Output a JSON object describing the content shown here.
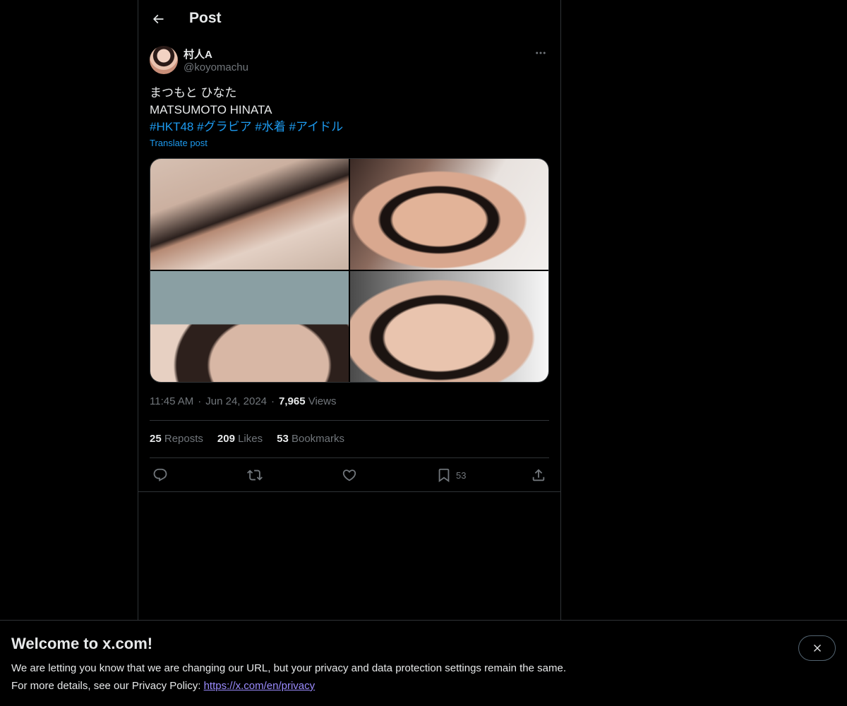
{
  "header": {
    "title": "Post",
    "back_icon": "arrow-left-icon"
  },
  "author": {
    "name": "村人A",
    "handle": "@koyomachu"
  },
  "post": {
    "line1": "まつもと ひなた",
    "line2": "MATSUMOTO HINATA",
    "hashtags": [
      "#HKT48",
      "#グラビア",
      "#水着",
      "#アイドル"
    ],
    "translate_label": "Translate post",
    "media_count": 4
  },
  "meta": {
    "time": "11:45 AM",
    "date": "Jun 24, 2024",
    "views_count": "7,965",
    "views_label": "Views",
    "separator": "·"
  },
  "stats": {
    "reposts_count": "25",
    "reposts_label": "Reposts",
    "likes_count": "209",
    "likes_label": "Likes",
    "bookmarks_count": "53",
    "bookmarks_label": "Bookmarks"
  },
  "actions": {
    "bookmark_count": "53"
  },
  "banner": {
    "title": "Welcome to x.com!",
    "line1": "We are letting you know that we are changing our URL, but your privacy and data protection settings remain the same.",
    "line2_prefix": "For more details, see our Privacy Policy: ",
    "link": "https://x.com/en/privacy"
  },
  "colors": {
    "accent": "#1d9bf0",
    "background": "#000000",
    "border": "#2f3336",
    "muted": "#71767b",
    "link_banner": "#9b8cff"
  }
}
